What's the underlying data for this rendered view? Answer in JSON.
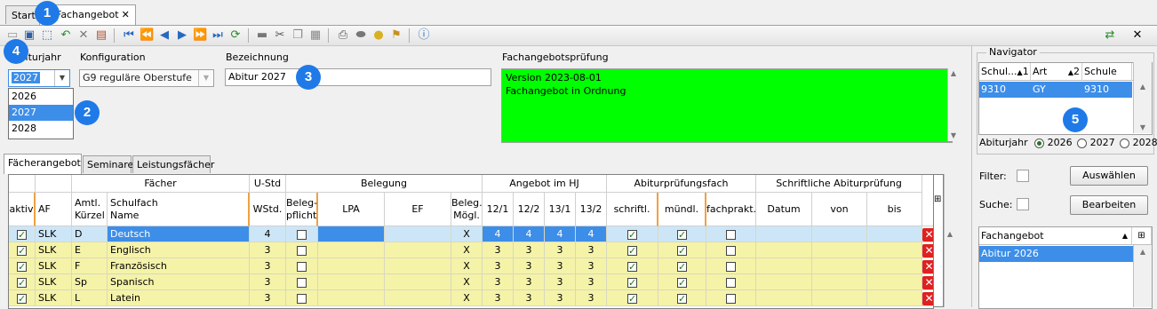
{
  "tabs": [
    {
      "label": "Start"
    },
    {
      "label": "Fachangebot",
      "close": "✕"
    }
  ],
  "toolbar": {
    "icons": [
      "new-icon",
      "save-icon",
      "select-icon",
      "undo-icon",
      "delete-icon",
      "properties-icon",
      "first-icon",
      "prev-page-icon",
      "prev-icon",
      "next-icon",
      "next-page-icon",
      "last-icon",
      "refresh-icon",
      "minus-icon",
      "cut-icon",
      "copy-icon",
      "paste-icon",
      "print-icon",
      "preview-icon",
      "bulb-icon",
      "clear-icon",
      "help-icon"
    ],
    "right_close": "✕"
  },
  "badges": [
    "1",
    "2",
    "3",
    "4",
    "5"
  ],
  "form": {
    "abiturjahr_label": "Abiturjahr",
    "abiturjahr_value": "2027",
    "abiturjahr_options": [
      "2026",
      "2027",
      "2028"
    ],
    "konfiguration_label": "Konfiguration",
    "konfiguration_value": "G9 reguläre Oberstufe",
    "bezeichnung_label": "Bezeichnung",
    "bezeichnung_value": "Abitur 2027",
    "pruefung_label": "Fachangebotsprüfung",
    "pruefung_lines": [
      "Version 2023-08-01",
      "Fachangebot in Ordnung"
    ]
  },
  "subtabs": [
    "Fächerangebot",
    "Seminare",
    "Leistungsfächer"
  ],
  "grid": {
    "group_headers": {
      "faecher": "Fächer",
      "ustd": "U-Std",
      "belegung": "Belegung",
      "angebot": "Angebot im HJ",
      "abiturfach": "Abiturprüfungsfach",
      "schriftlich": "Schriftliche Abiturprüfung"
    },
    "col_headers": {
      "aktiv": "aktiv",
      "af": "AF",
      "kuerzel_1": "Amtl.",
      "kuerzel_2": "Kürzel",
      "name_1": "Schulfach",
      "name_2": "Name",
      "wstd": "WStd.",
      "belegpflicht_1": "Beleg-",
      "belegpflicht_2": "pflicht",
      "lpa": "LPA",
      "ef": "EF",
      "belegmoegl_1": "Beleg.",
      "belegmoegl_2": "Mögl.",
      "hj1": "12/1",
      "hj2": "12/2",
      "hj3": "13/1",
      "hj4": "13/2",
      "schriftl": "schriftl.",
      "muendl": "mündl.",
      "fachprakt": "fachprakt.",
      "datum": "Datum",
      "von": "von",
      "bis": "bis"
    },
    "rows": [
      {
        "aktiv": true,
        "af": "SLK",
        "kuerzel": "D",
        "name": "Deutsch",
        "wstd": "4",
        "belegpflicht": false,
        "belegmoegl": "X",
        "hj": [
          "4",
          "4",
          "4",
          "4"
        ],
        "schriftl": true,
        "muendl": true,
        "fachprakt": false,
        "selected": true
      },
      {
        "aktiv": true,
        "af": "SLK",
        "kuerzel": "E",
        "name": "Englisch",
        "wstd": "3",
        "belegpflicht": false,
        "belegmoegl": "X",
        "hj": [
          "3",
          "3",
          "3",
          "3"
        ],
        "schriftl": true,
        "muendl": true,
        "fachprakt": false,
        "selected": false
      },
      {
        "aktiv": true,
        "af": "SLK",
        "kuerzel": "F",
        "name": "Französisch",
        "wstd": "3",
        "belegpflicht": false,
        "belegmoegl": "X",
        "hj": [
          "3",
          "3",
          "3",
          "3"
        ],
        "schriftl": true,
        "muendl": true,
        "fachprakt": false,
        "selected": false
      },
      {
        "aktiv": true,
        "af": "SLK",
        "kuerzel": "Sp",
        "name": "Spanisch",
        "wstd": "3",
        "belegpflicht": false,
        "belegmoegl": "X",
        "hj": [
          "3",
          "3",
          "3",
          "3"
        ],
        "schriftl": true,
        "muendl": true,
        "fachprakt": false,
        "selected": false
      },
      {
        "aktiv": true,
        "af": "SLK",
        "kuerzel": "L",
        "name": "Latein",
        "wstd": "3",
        "belegpflicht": false,
        "belegmoegl": "X",
        "hj": [
          "3",
          "3",
          "3",
          "3"
        ],
        "schriftl": true,
        "muendl": true,
        "fachprakt": false,
        "selected": false
      }
    ]
  },
  "navigator": {
    "title": "Navigator",
    "headers": [
      "Schul...",
      "1",
      "Art",
      "2",
      "Schule"
    ],
    "row": [
      "9310",
      "GY",
      "9310"
    ],
    "abiturjahr_label": "Abiturjahr",
    "abiturjahr_options": [
      "2026",
      "2027",
      "2028"
    ],
    "abiturjahr_selected": "2026",
    "filter_label": "Filter:",
    "auswaehlen": "Auswählen",
    "suche_label": "Suche:",
    "bearbeiten": "Bearbeiten",
    "fachangebot_header": "Fachangebot",
    "fachangebot_item": "Abitur 2026"
  },
  "colors": {
    "selection": "#3d8ee8",
    "row_yellow": "#f5f3a8",
    "check_green": "#00ff00",
    "badge": "#1f7ae8",
    "delete_red": "#e02020"
  }
}
